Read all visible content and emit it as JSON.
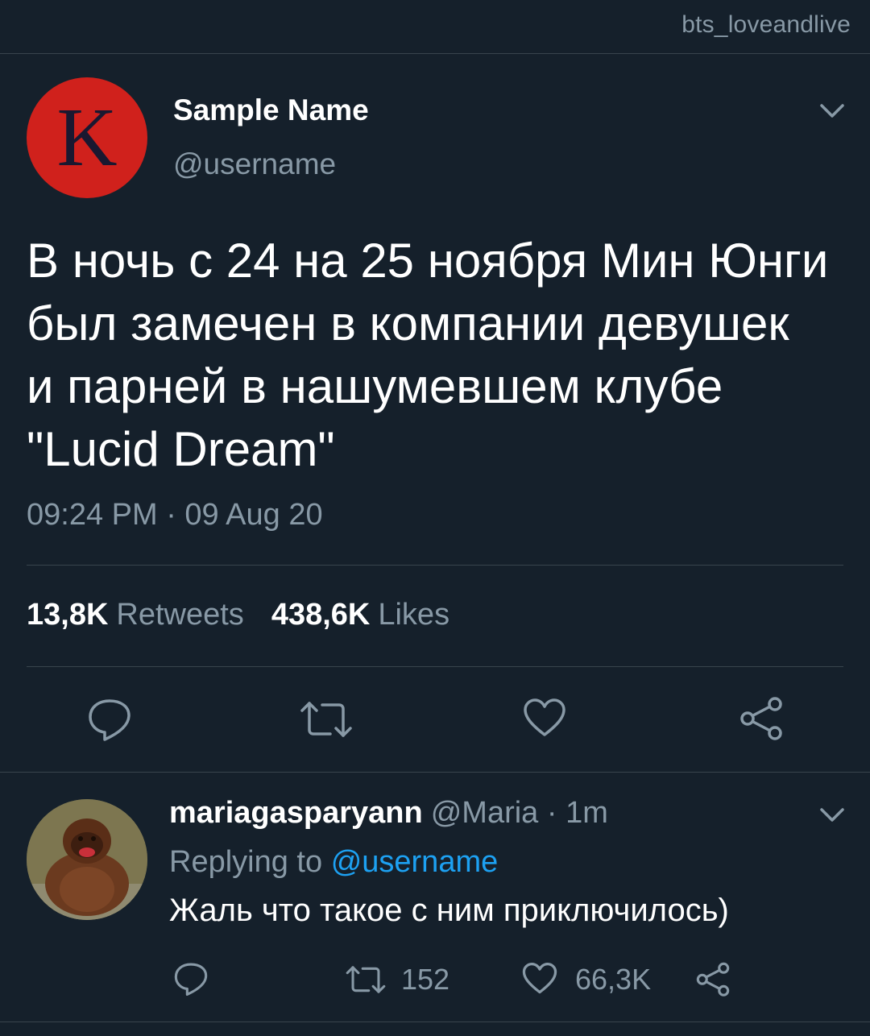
{
  "watermark": "bts_loveandlive",
  "tweet": {
    "avatar_letter": "K",
    "display_name": "Sample Name",
    "handle": "@username",
    "text": "В ночь с 24 на 25 ноября Мин Юнги\nбыл замечен в компании девушек\nи парней в нашумевшем клубе\n\"Lucid Dream\"",
    "timestamp": "09:24 PM · 09 Aug 20",
    "retweet_count": "13,8K",
    "retweet_label": "Retweets",
    "like_count": "438,6K",
    "like_label": "Likes"
  },
  "reply": {
    "name": "mariagasparyann",
    "meta": "@Maria · 1m",
    "replying_prefix": "Replying to",
    "replying_handle": "@username",
    "text": "Жаль что такое с ним приключилось)",
    "retweet_count": "152",
    "like_count": "66,3K"
  },
  "colors": {
    "background": "#15202b",
    "divider": "#38444d",
    "muted": "#8899a6",
    "link": "#1da1f2",
    "avatar_red": "#d0211c"
  }
}
